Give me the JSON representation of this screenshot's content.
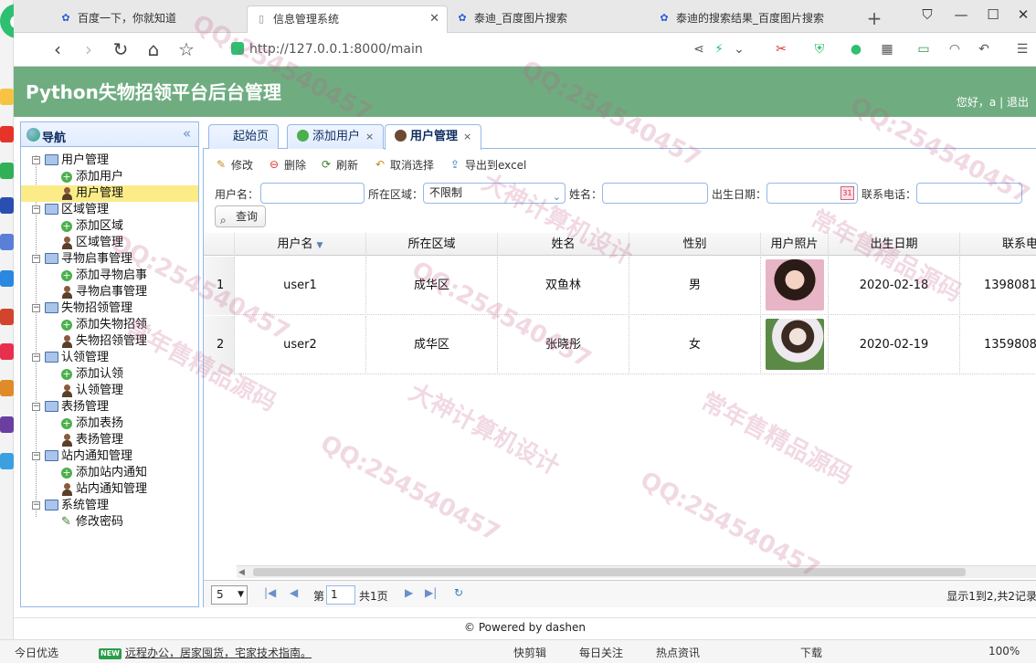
{
  "browser": {
    "tabs": [
      {
        "title": "百度一下，你就知道",
        "icon": "baidu-paw-icon"
      },
      {
        "title": "信息管理系统",
        "icon": "page-icon"
      },
      {
        "title": "泰迪_百度图片搜索",
        "icon": "baidu-paw-icon"
      },
      {
        "title": "泰迪的搜索结果_百度图片搜索",
        "icon": "baidu-paw-icon"
      }
    ],
    "url": "http://127.0.0.1:8000/main"
  },
  "header": {
    "title": "Python失物招领平台后台管理",
    "greeting": "您好，a",
    "logout": "退出"
  },
  "sidebar": {
    "title": "导航",
    "groups": [
      {
        "label": "用户管理",
        "children": [
          "添加用户",
          "用户管理"
        ]
      },
      {
        "label": "区域管理",
        "children": [
          "添加区域",
          "区域管理"
        ]
      },
      {
        "label": "寻物启事管理",
        "children": [
          "添加寻物启事",
          "寻物启事管理"
        ]
      },
      {
        "label": "失物招领管理",
        "children": [
          "添加失物招领",
          "失物招领管理"
        ]
      },
      {
        "label": "认领管理",
        "children": [
          "添加认领",
          "认领管理"
        ]
      },
      {
        "label": "表扬管理",
        "children": [
          "添加表扬",
          "表扬管理"
        ]
      },
      {
        "label": "站内通知管理",
        "children": [
          "添加站内通知",
          "站内通知管理"
        ]
      },
      {
        "label": "系统管理",
        "children": [
          "修改密码"
        ]
      }
    ],
    "selected": "用户管理"
  },
  "content_tabs": [
    "起始页",
    "添加用户",
    "用户管理"
  ],
  "toolbar": {
    "edit": "修改",
    "delete": "删除",
    "refresh": "刷新",
    "unselect": "取消选择",
    "export": "导出到excel"
  },
  "search": {
    "username_label": "用户名：",
    "area_label": "所在区域：",
    "area_value": "不限制",
    "name_label": "姓名：",
    "birth_label": "出生日期：",
    "phone_label": "联系电话：",
    "query_button": "查询"
  },
  "grid": {
    "columns": [
      "用户名",
      "所在区域",
      "姓名",
      "性别",
      "用户照片",
      "出生日期",
      "联系电"
    ],
    "rows": [
      {
        "num": "1",
        "username": "user1",
        "area": "成华区",
        "name": "双鱼林",
        "gender": "男",
        "birth": "2020-02-18",
        "phone": "1398081"
      },
      {
        "num": "2",
        "username": "user2",
        "area": "成华区",
        "name": "张晓彤",
        "gender": "女",
        "birth": "2020-02-19",
        "phone": "1359808"
      }
    ]
  },
  "pager": {
    "page_size": "5",
    "page_prefix": "第",
    "page_value": "1",
    "page_total": "共1页",
    "info": "显示1到2,共2记录"
  },
  "footer": "© Powered by dashen",
  "statusbar": {
    "today": "今日优选",
    "news": "远程办公，居家囤货，宅家技术指南。",
    "quick_clip": "快剪辑",
    "daily": "每日关注",
    "hot": "热点资讯",
    "download": "下载",
    "zoom": "100%"
  },
  "watermark": {
    "qq": "QQ:254540457",
    "line1": "大神计算机设计",
    "line2": "常年售精品源码"
  }
}
